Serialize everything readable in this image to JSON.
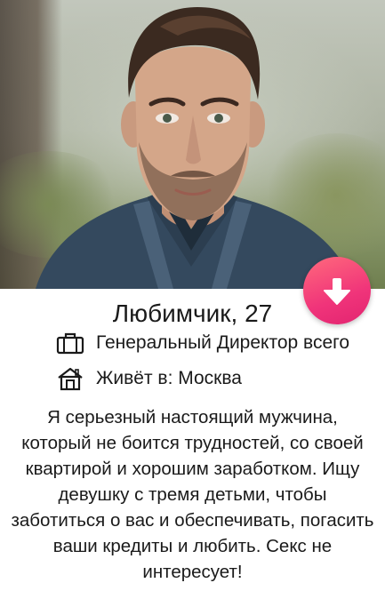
{
  "profile": {
    "name_age": "Любимчик, 27",
    "job": "Генеральный Директор всего",
    "location": "Живёт в: Москва",
    "bio": "Я серьезный настоящий мужчина, который не боится трудностей, со своей квартирой и хорошим заработком. Ищу девушку с тремя детьми, чтобы заботиться о вас и обеспечивать, погасить ваши кредиты и любить. Секс не интересует!"
  },
  "icons": {
    "favorite": "arrow-down-icon",
    "job": "briefcase-icon",
    "location": "house-icon"
  },
  "colors": {
    "accent_start": "#ff6a7c",
    "accent_end": "#e22470",
    "text": "#1a1a1a"
  }
}
